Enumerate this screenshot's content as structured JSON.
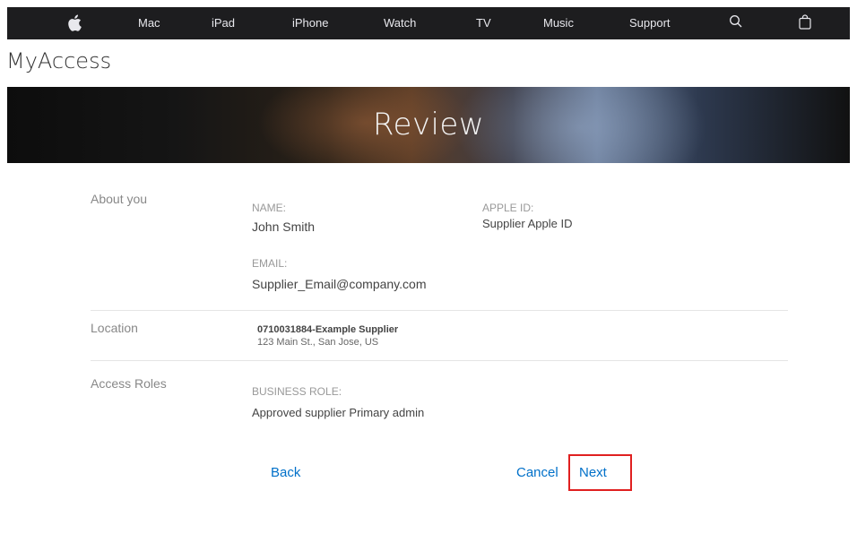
{
  "nav": {
    "icons": {
      "apple": "apple-logo-icon",
      "search": "search-icon",
      "bag": "shopping-bag-icon"
    },
    "items": [
      "Mac",
      "iPad",
      "iPhone",
      "Watch",
      "TV",
      "Music",
      "Support"
    ]
  },
  "brand": {
    "title": "MyAccess"
  },
  "hero": {
    "title": "Review"
  },
  "about": {
    "label": "About you",
    "name_label": "NAME:",
    "name_value": "John Smith",
    "apple_id_label": "APPLE ID:",
    "apple_id_value": "Supplier Apple ID",
    "email_label": "EMAIL:",
    "email_value": "Supplier_Email@company.com"
  },
  "location": {
    "label": "Location",
    "code": "0710031884-Example Supplier",
    "address": "123 Main St., San Jose, US"
  },
  "roles": {
    "label": "Access Roles",
    "business_role_label": "BUSINESS ROLE:",
    "business_role_value": "Approved supplier Primary admin"
  },
  "actions": {
    "back": "Back",
    "cancel": "Cancel",
    "next": "Next"
  },
  "colors": {
    "nav_bg": "#1d1d1f",
    "link": "#0070c9",
    "highlight": "#e02020"
  }
}
